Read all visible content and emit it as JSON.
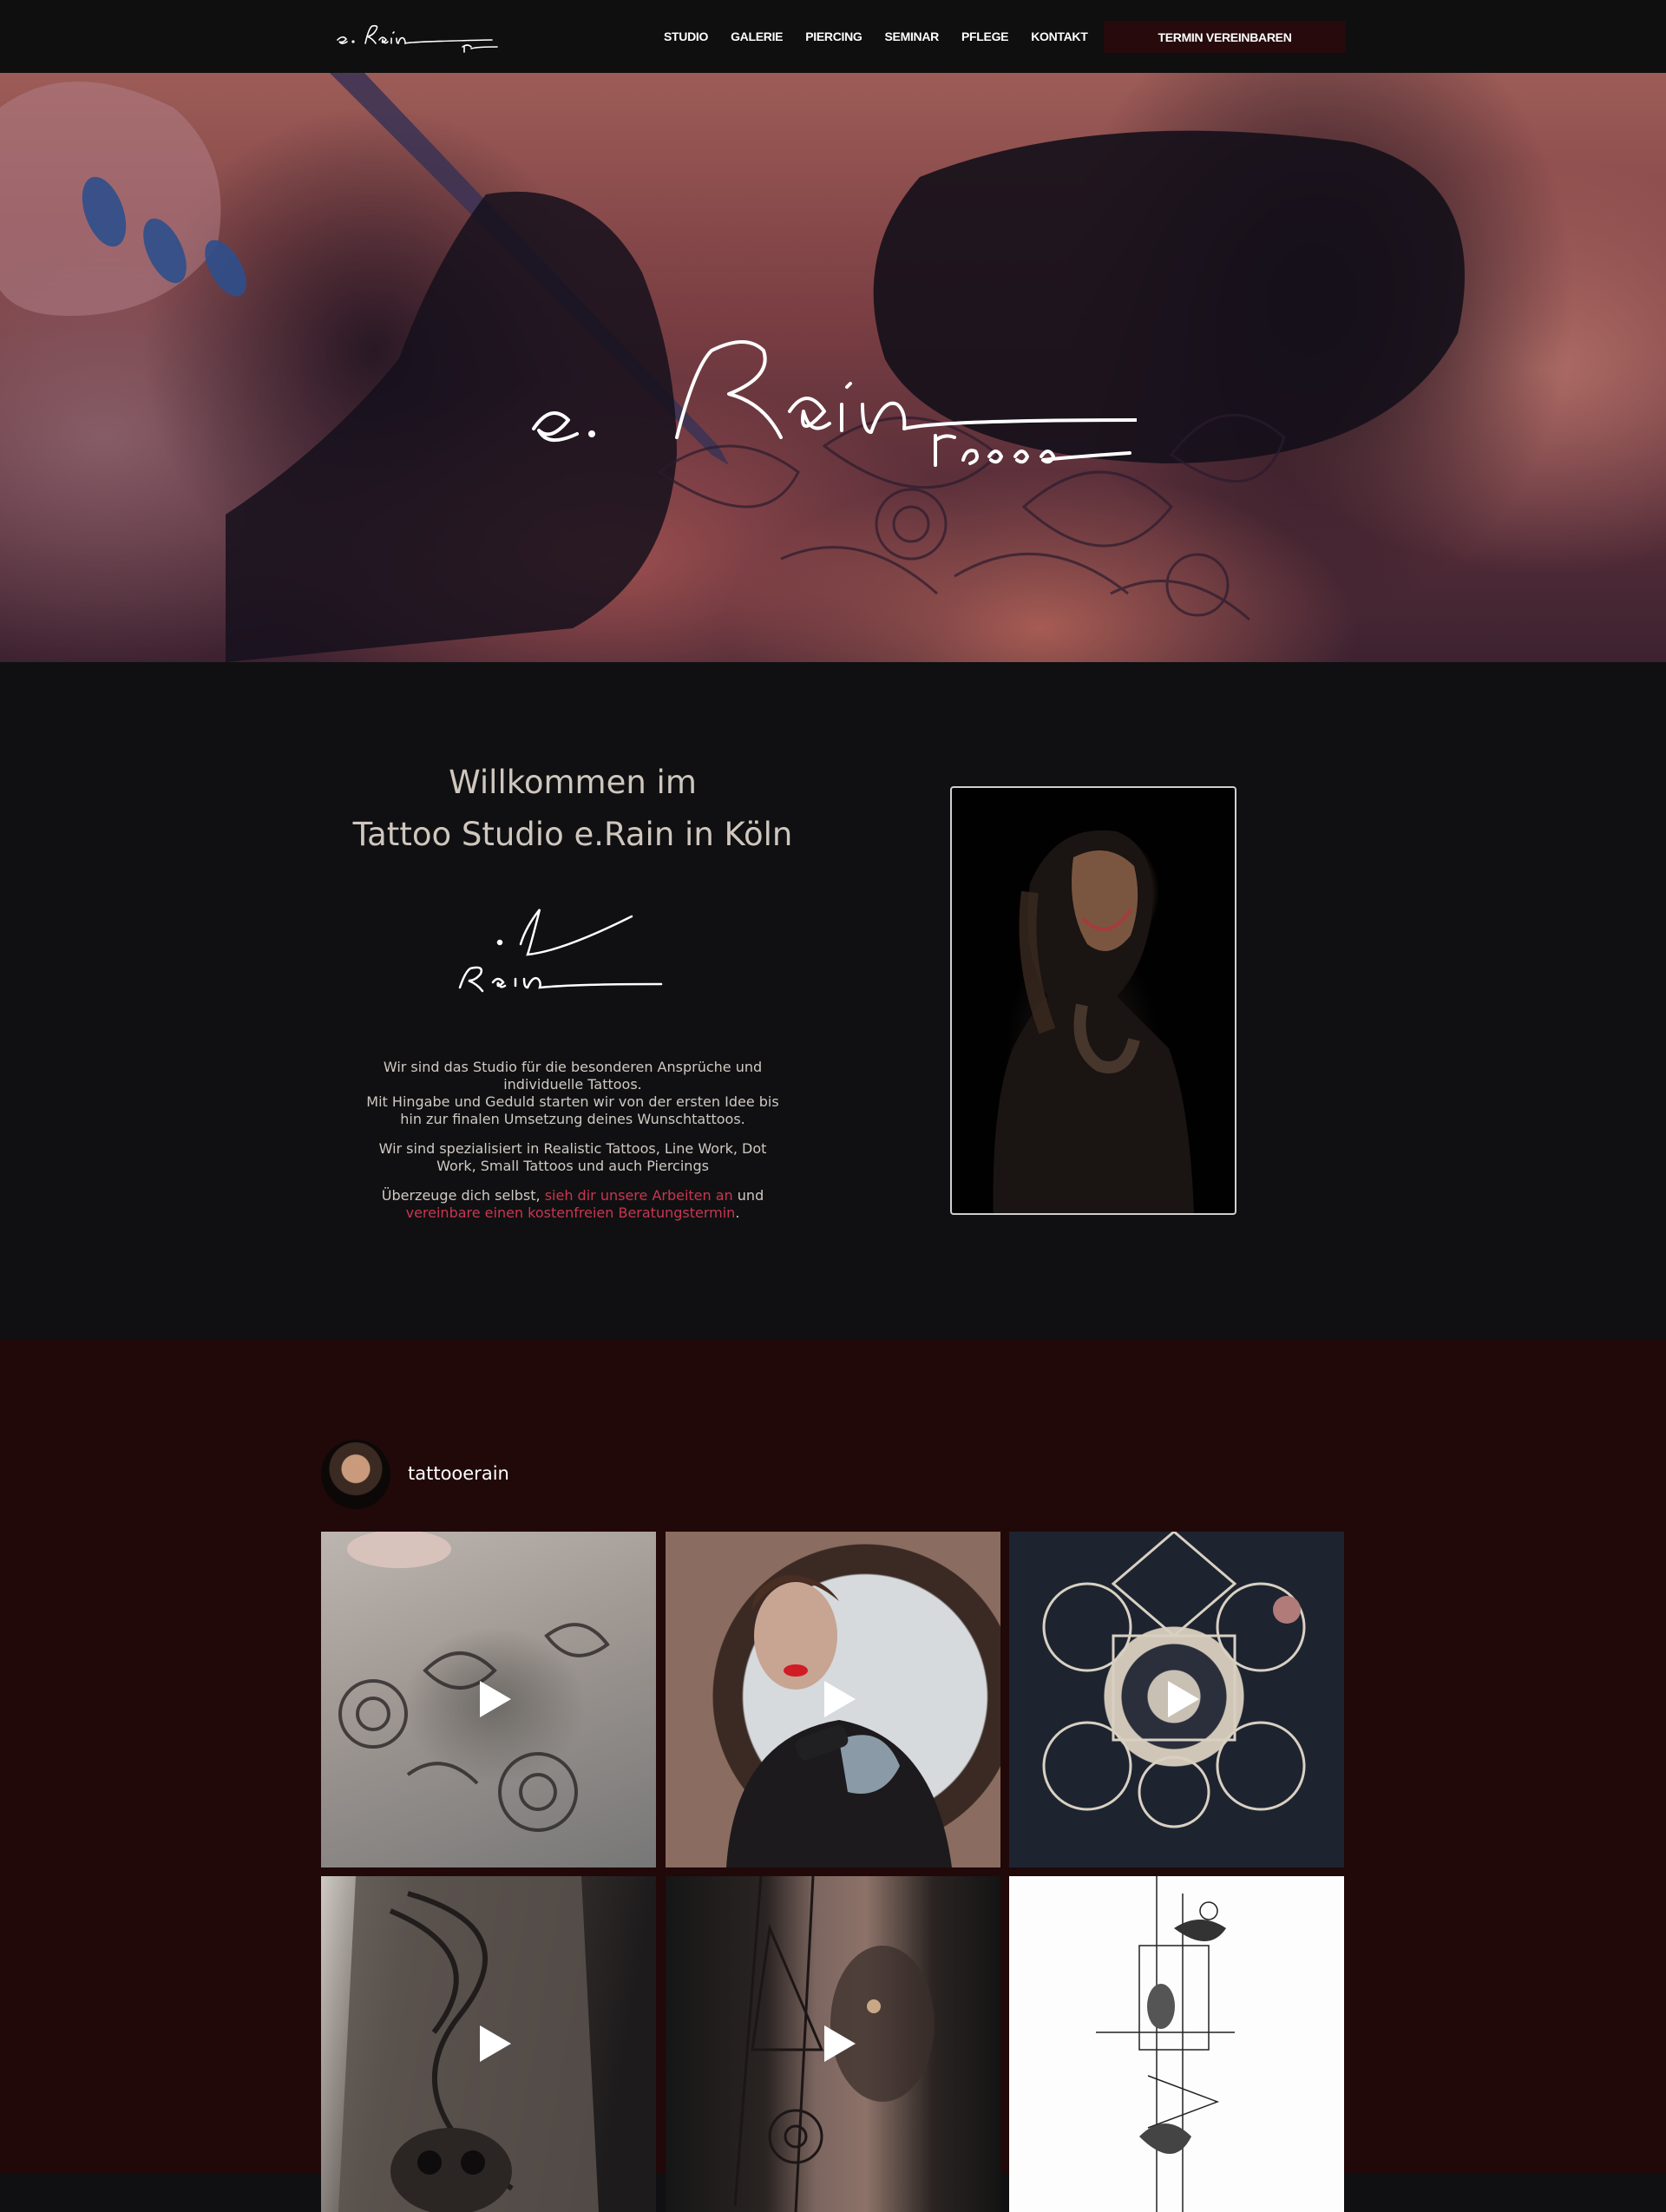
{
  "nav": {
    "logo_alt": "e. Rain Tattoo",
    "items": [
      "STUDIO",
      "GALERIE",
      "PIERCING",
      "SEMINAR",
      "PFLEGE",
      "KONTAKT"
    ],
    "cta_label": "TERMIN VEREINBAREN"
  },
  "hero": {
    "logo_alt": "e. Rain Tattoo"
  },
  "welcome": {
    "title_line1": "Willkommen im",
    "title_line2": "Tattoo Studio e.Rain in Köln",
    "p1_line1": "Wir sind das Studio für die besonderen Ansprüche und individuelle Tattoos.",
    "p1_line2": "Mit Hingabe und Geduld starten wir von der ersten Idee bis hin zur finalen Umsetzung deines Wunschtattoos.",
    "p2": "Wir sind spezialisiert in Realistic Tattoos, Line Work, Dot Work, Small Tattoos und auch Piercings",
    "p3_prefix": "Überzeuge dich selbst, ",
    "p3_link1": "sieh dir unsere Arbeiten an",
    "p3_mid": " und ",
    "p3_link2": "vereinbare einen kostenfreien Beratungstermin",
    "p3_suffix": "."
  },
  "instagram": {
    "username": "tattooerain",
    "posts": [
      {
        "type": "video",
        "subject": "floral leg tattoo"
      },
      {
        "type": "video",
        "subject": "artist portrait with tattoo machine"
      },
      {
        "type": "video",
        "subject": "sacred geometry back tattoo"
      },
      {
        "type": "video",
        "subject": "snake and skull forearm tattoo"
      },
      {
        "type": "video",
        "subject": "lion and geometric forearm tattoo"
      },
      {
        "type": "image",
        "subject": "line art tattoo design sketch"
      }
    ]
  },
  "colors": {
    "nav_bg": "#0f0f10",
    "cta_bg": "#260a0c",
    "page_bg": "#101012",
    "insta_bg": "#210809",
    "link": "#c9364f",
    "title": "#cfc7be"
  },
  "icons": [
    "play-icon"
  ]
}
